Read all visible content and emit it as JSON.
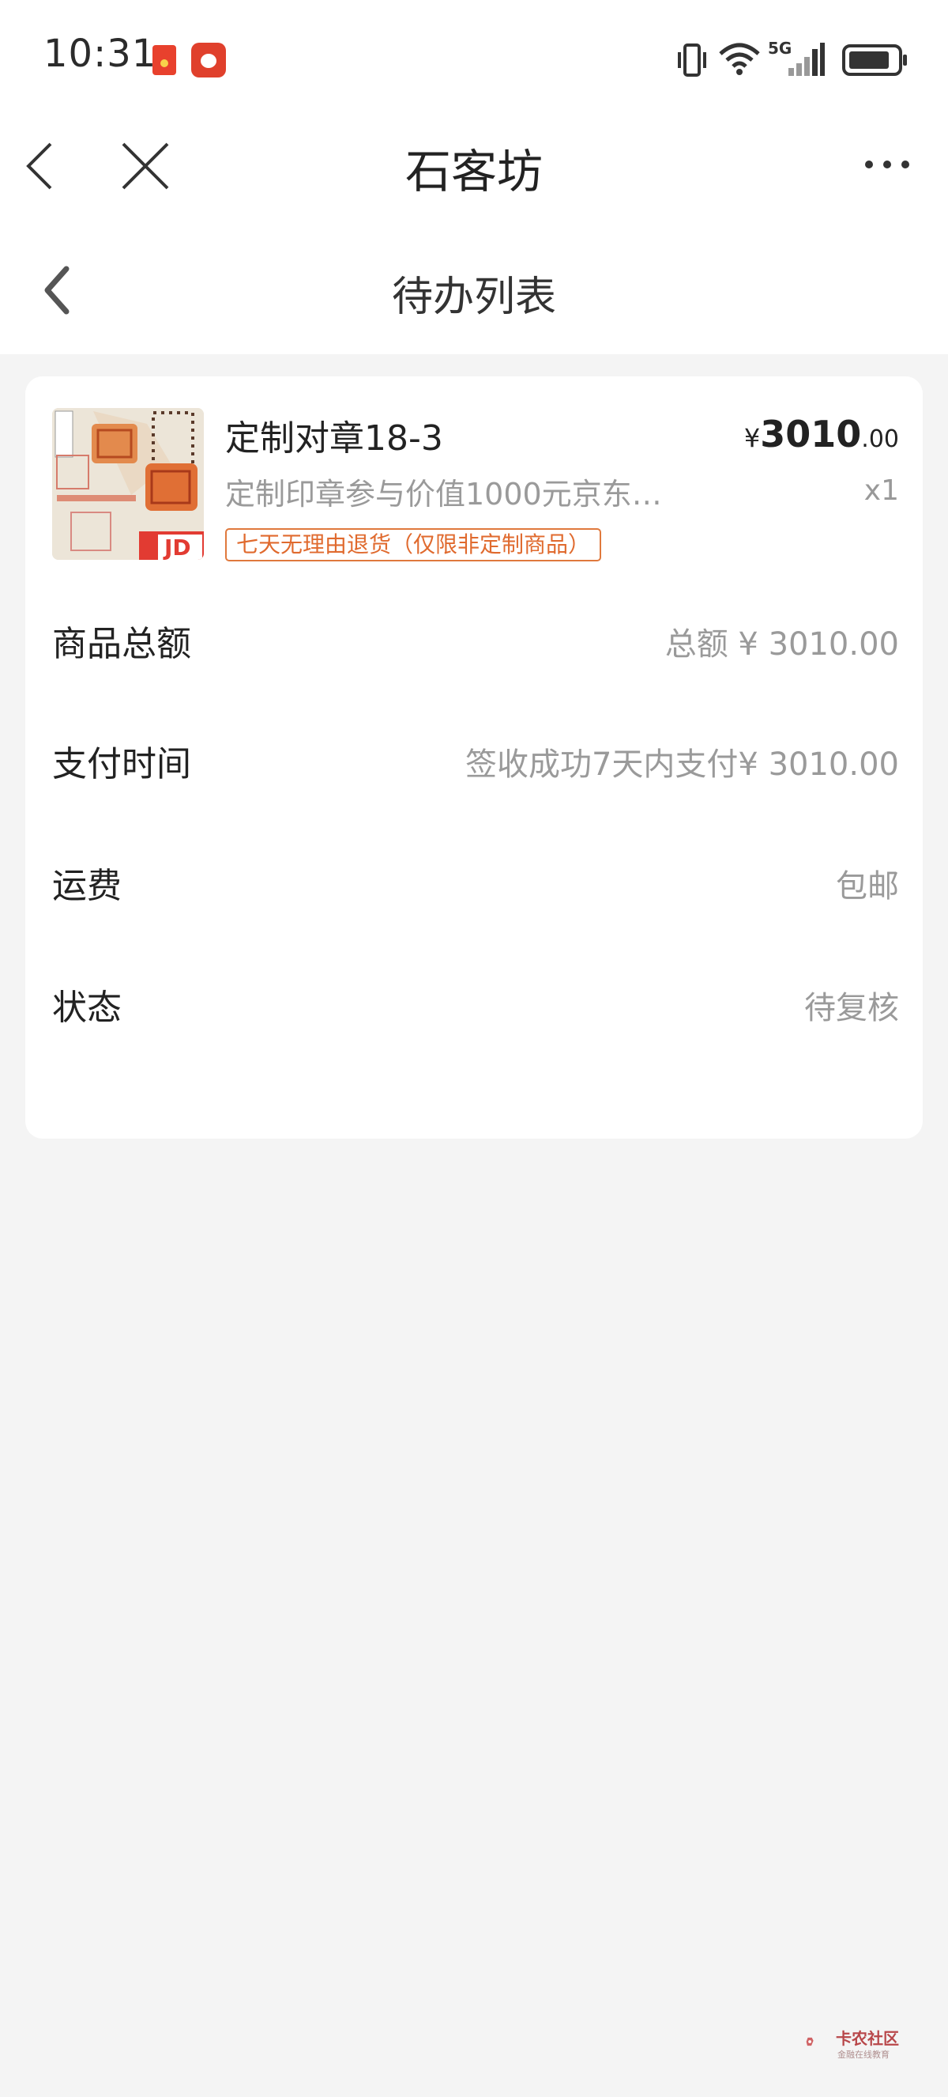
{
  "status_bar": {
    "time": "10:31",
    "network": "5G"
  },
  "nav": {
    "title": "石客坊"
  },
  "subheader": {
    "title": "待办列表"
  },
  "product": {
    "name": "定制对章18-3",
    "description": "定制印章参与价值1000元京东E…",
    "tag": "七天无理由退货（仅限非定制商品）",
    "price_currency": "¥",
    "price_int": "3010",
    "price_dec": ".00",
    "quantity": "x1"
  },
  "rows": [
    {
      "label": "商品总额",
      "value": "总额 ¥ 3010.00"
    },
    {
      "label": "支付时间",
      "value": "签收成功7天内支付¥ 3010.00"
    },
    {
      "label": "运费",
      "value": "包邮"
    },
    {
      "label": "状态",
      "value": "待复核"
    }
  ],
  "watermark": {
    "title": "卡农社区",
    "subtitle": "金融在线教育"
  },
  "colors": {
    "tag_orange": "#e06a2e",
    "background": "#f4f4f4",
    "card": "#ffffff"
  }
}
